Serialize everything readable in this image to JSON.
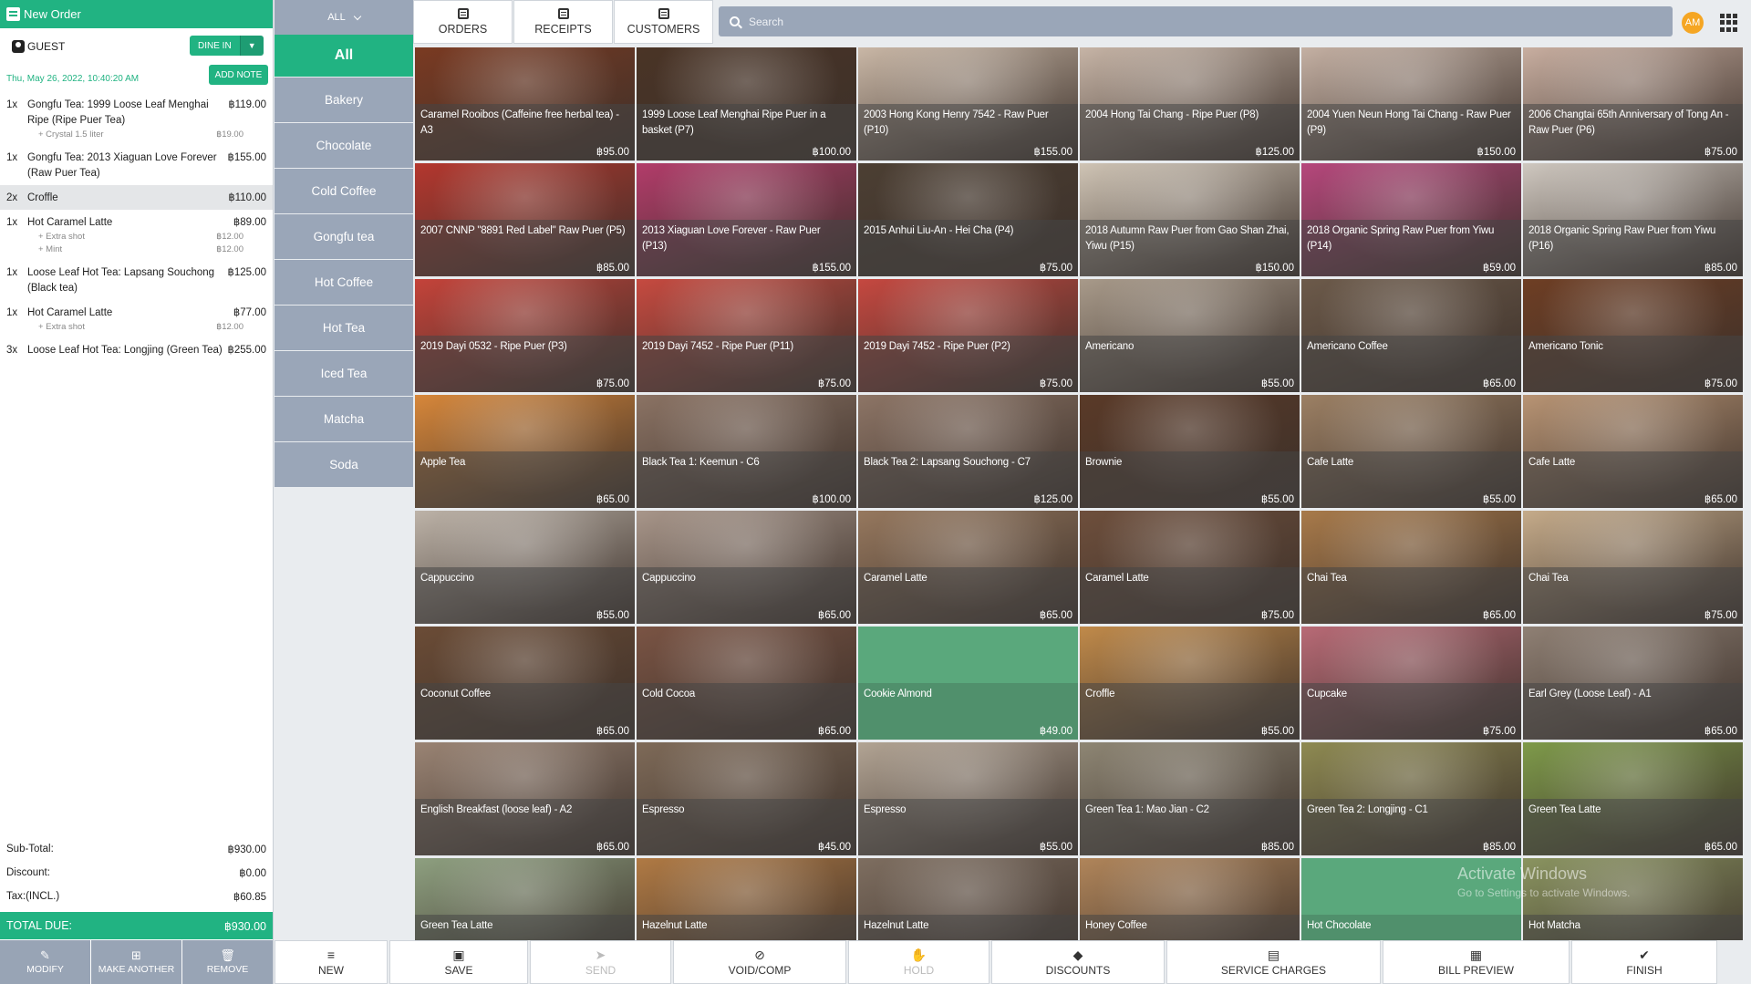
{
  "order": {
    "title": "New Order",
    "guest": "GUEST",
    "dine_in": "DINE IN",
    "datetime": "Thu, May 26, 2022, 10:40:20 AM",
    "add_note": "ADD NOTE",
    "items": [
      {
        "qty": "1x",
        "name": "Gongfu Tea: 1999 Loose Leaf Menghai Ripe (Ripe Puer Tea)",
        "price": "฿119.00",
        "mods": [
          {
            "name": "+ Crystal 1.5 liter",
            "price": "฿19.00"
          }
        ]
      },
      {
        "qty": "1x",
        "name": "Gongfu Tea: 2013 Xiaguan Love Forever (Raw Puer Tea)",
        "price": "฿155.00",
        "mods": []
      },
      {
        "qty": "2x",
        "name": "Croffle",
        "price": "฿110.00",
        "mods": []
      },
      {
        "qty": "1x",
        "name": "Hot Caramel Latte",
        "price": "฿89.00",
        "mods": [
          {
            "name": "+ Extra shot",
            "price": "฿12.00"
          },
          {
            "name": "+ Mint",
            "price": "฿12.00"
          }
        ]
      },
      {
        "qty": "1x",
        "name": "Loose Leaf Hot Tea: Lapsang Souchong (Black tea)",
        "price": "฿125.00",
        "mods": []
      },
      {
        "qty": "1x",
        "name": "Hot Caramel Latte",
        "price": "฿77.00",
        "mods": [
          {
            "name": "+ Extra shot",
            "price": "฿12.00"
          }
        ]
      },
      {
        "qty": "3x",
        "name": "Loose Leaf Hot Tea: Longjing (Green Tea)",
        "price": "฿255.00",
        "mods": []
      }
    ],
    "subtotal_label": "Sub-Total:",
    "subtotal": "฿930.00",
    "discount_label": "Discount:",
    "discount": "฿0.00",
    "tax_label": "Tax:(INCL.)",
    "tax": "฿60.85",
    "total_label": "TOTAL DUE:",
    "total": "฿930.00",
    "actions": [
      {
        "name": "modify",
        "label": "MODIFY",
        "glyph": "✎"
      },
      {
        "name": "make-another",
        "label": "MAKE ANOTHER",
        "glyph": "⊞"
      },
      {
        "name": "remove",
        "label": "REMOVE",
        "glyph": "🗑"
      }
    ]
  },
  "categories": {
    "filter": "ALL",
    "items": [
      "All",
      "Bakery",
      "Chocolate",
      "Cold Coffee",
      "Gongfu tea",
      "Hot Coffee",
      "Hot Tea",
      "Iced Tea",
      "Matcha",
      "Soda"
    ]
  },
  "tabs": [
    "ORDERS",
    "RECEIPTS",
    "CUSTOMERS"
  ],
  "search": {
    "placeholder": "Search"
  },
  "user": {
    "initials": "AM"
  },
  "products": [
    {
      "name": "Caramel Rooibos (Caffeine free herbal tea) - A3",
      "price": "฿95.00",
      "color": "#7a3a22"
    },
    {
      "name": "1999 Loose Leaf Menghai Ripe Puer in a basket (P7)",
      "price": "฿100.00",
      "color": "#4a3426"
    },
    {
      "name": "2003 Hong Kong Henry 7542 - Raw Puer (P10)",
      "price": "฿155.00",
      "color": "#c9b7a6"
    },
    {
      "name": "2004 Hong Tai Chang - Ripe Puer (P8)",
      "price": "฿125.00",
      "color": "#c6b4a6"
    },
    {
      "name": "2004 Yuen Neun Hong Tai Chang - Raw Puer (P9)",
      "price": "฿150.00",
      "color": "#c4b0a3"
    },
    {
      "name": "2006 Changtai 65th Anniversary of Tong An - Raw Puer (P6)",
      "price": "฿75.00",
      "color": "#c8aea0"
    },
    {
      "name": "2007 CNNP \"8891 Red Label\" Raw Puer (P5)",
      "price": "฿85.00",
      "color": "#b4372e"
    },
    {
      "name": "2013 Xiaguan Love Forever - Raw Puer (P13)",
      "price": "฿155.00",
      "color": "#b23c6a"
    },
    {
      "name": "2015 Anhui Liu-An - Hei Cha (P4)",
      "price": "฿75.00",
      "color": "#4c3f33"
    },
    {
      "name": "2018 Autumn Raw Puer from Gao Shan Zhai, Yiwu (P15)",
      "price": "฿150.00",
      "color": "#cfc4b5"
    },
    {
      "name": "2018 Organic Spring Raw Puer from Yiwu (P14)",
      "price": "฿59.00",
      "color": "#b6477c"
    },
    {
      "name": "2018 Organic Spring Raw Puer from Yiwu (P16)",
      "price": "฿85.00",
      "color": "#cfc8c0"
    },
    {
      "name": "2019 Dayi 0532 - Ripe Puer (P3)",
      "price": "฿75.00",
      "color": "#c4433a"
    },
    {
      "name": "2019 Dayi 7452 - Ripe Puer (P11)",
      "price": "฿75.00",
      "color": "#c64a40"
    },
    {
      "name": "2019 Dayi 7452 - Ripe Puer (P2)",
      "price": "฿75.00",
      "color": "#c54840"
    },
    {
      "name": "Americano",
      "price": "฿55.00",
      "color": "#a89a8a"
    },
    {
      "name": "Americano Coffee",
      "price": "฿65.00",
      "color": "#6c5a4a"
    },
    {
      "name": "Americano Tonic",
      "price": "฿75.00",
      "color": "#6e3e24"
    },
    {
      "name": "Apple Tea",
      "price": "฿65.00",
      "color": "#d7873a"
    },
    {
      "name": "Black Tea 1: Keemun - C6",
      "price": "฿100.00",
      "color": "#8b7364"
    },
    {
      "name": "Black Tea 2: Lapsang Souchong - C7",
      "price": "฿125.00",
      "color": "#8d7566"
    },
    {
      "name": "Brownie",
      "price": "฿55.00",
      "color": "#5a3a28"
    },
    {
      "name": "Cafe Latte",
      "price": "฿55.00",
      "color": "#9c8064"
    },
    {
      "name": "Cafe Latte",
      "price": "฿65.00",
      "color": "#b89474"
    },
    {
      "name": "Cappuccino",
      "price": "฿55.00",
      "color": "#bdb3a8"
    },
    {
      "name": "Cappuccino",
      "price": "฿65.00",
      "color": "#a8968a"
    },
    {
      "name": "Caramel Latte",
      "price": "฿65.00",
      "color": "#96785e"
    },
    {
      "name": "Caramel Latte",
      "price": "฿75.00",
      "color": "#6e4f3c"
    },
    {
      "name": "Chai Tea",
      "price": "฿65.00",
      "color": "#a87a4a"
    },
    {
      "name": "Chai Tea",
      "price": "฿75.00",
      "color": "#c5ab8a"
    },
    {
      "name": "Coconut Coffee",
      "price": "฿65.00",
      "color": "#6b4c36"
    },
    {
      "name": "Cold Cocoa",
      "price": "฿65.00",
      "color": "#7a5444"
    },
    {
      "name": "Cookie Almond",
      "price": "฿49.00",
      "color": "#5aa87c",
      "plain": true
    },
    {
      "name": "Croffle",
      "price": "฿55.00",
      "color": "#c08a4a"
    },
    {
      "name": "Cupcake",
      "price": "฿75.00",
      "color": "#b86a76"
    },
    {
      "name": "Earl Grey (Loose Leaf) - A1",
      "price": "฿65.00",
      "color": "#8f8074"
    },
    {
      "name": "English Breakfast (loose leaf) - A2",
      "price": "฿65.00",
      "color": "#9a8474"
    },
    {
      "name": "Espresso",
      "price": "฿45.00",
      "color": "#7e6a58"
    },
    {
      "name": "Espresso",
      "price": "฿55.00",
      "color": "#b2a494"
    },
    {
      "name": "Green Tea 1: Mao Jian - C2",
      "price": "฿85.00",
      "color": "#8e8674"
    },
    {
      "name": "Green Tea 2: Longjing - C1",
      "price": "฿85.00",
      "color": "#8e8a52"
    },
    {
      "name": "Green Tea Latte",
      "price": "฿65.00",
      "color": "#7e9a4a"
    },
    {
      "name": "Green Tea Latte",
      "price": "",
      "color": "#8ea080"
    },
    {
      "name": "Hazelnut Latte",
      "price": "",
      "color": "#b07a44"
    },
    {
      "name": "Hazelnut Latte",
      "price": "",
      "color": "#7e6e60"
    },
    {
      "name": "Honey Coffee",
      "price": "",
      "color": "#b0855a"
    },
    {
      "name": "Hot Chocolate",
      "price": "",
      "color": "#5aa87c",
      "plain": true
    },
    {
      "name": "Hot Matcha",
      "price": "",
      "color": "#8a9460"
    }
  ],
  "bottom_actions": [
    {
      "name": "new",
      "label": "NEW",
      "glyph": "≡",
      "disabled": false,
      "w": 124
    },
    {
      "name": "save",
      "label": "SAVE",
      "glyph": "▣",
      "disabled": false,
      "w": 152
    },
    {
      "name": "send",
      "label": "SEND",
      "glyph": "➤",
      "disabled": true,
      "w": 155
    },
    {
      "name": "void-comp",
      "label": "VOID/COMP",
      "glyph": "⊘",
      "disabled": false,
      "w": 190
    },
    {
      "name": "hold",
      "label": "HOLD",
      "glyph": "✋",
      "disabled": true,
      "w": 155
    },
    {
      "name": "discounts",
      "label": "DISCOUNTS",
      "glyph": "◆",
      "disabled": false,
      "w": 190
    },
    {
      "name": "service-charges",
      "label": "SERVICE CHARGES",
      "glyph": "▤",
      "disabled": false,
      "w": 235
    },
    {
      "name": "bill-preview",
      "label": "BILL PREVIEW",
      "glyph": "▦",
      "disabled": false,
      "w": 205
    },
    {
      "name": "finish",
      "label": "FINISH",
      "glyph": "✔",
      "disabled": false,
      "w": 160
    }
  ],
  "watermark": {
    "line1": "Activate Windows",
    "line2": "Go to Settings to activate Windows."
  }
}
